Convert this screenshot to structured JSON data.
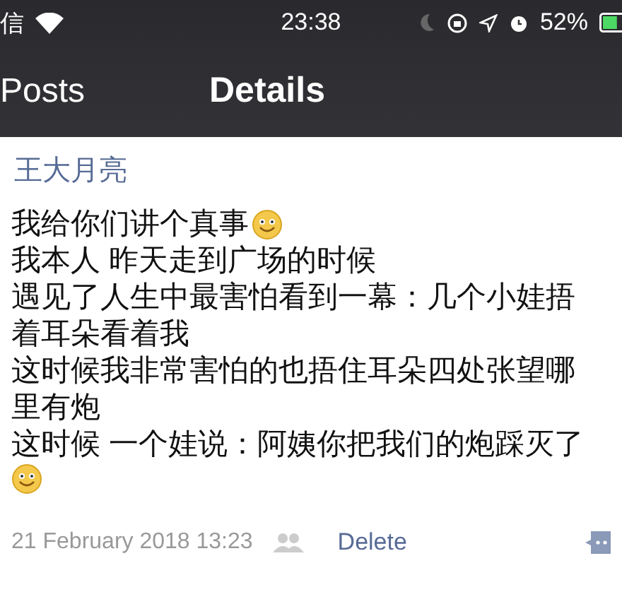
{
  "status_bar": {
    "carrier": "信",
    "time": "23:38",
    "battery": "52%"
  },
  "nav": {
    "back": "Posts",
    "title": "Details"
  },
  "post": {
    "author": "王大月亮",
    "lines": [
      {
        "text": "我给你们讲个真事",
        "emoji": true
      },
      {
        "text": "我本人 昨天走到广场的时候",
        "emoji": false
      },
      {
        "text": "遇见了人生中最害怕看到一幕：几个小娃捂",
        "emoji": false
      },
      {
        "text": "着耳朵看着我",
        "emoji": false
      },
      {
        "text": "这时候我非常害怕的也捂住耳朵四处张望哪",
        "emoji": false
      },
      {
        "text": "里有炮",
        "emoji": false
      },
      {
        "text": "这时候 一个娃说：阿姨你把我们的炮踩灭了",
        "emoji": false
      },
      {
        "emoji": true
      }
    ],
    "time": "21 February 2018 13:23",
    "delete": "Delete"
  }
}
